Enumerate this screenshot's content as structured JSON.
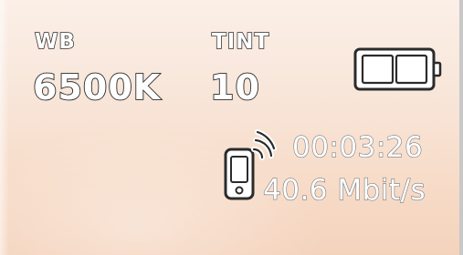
{
  "white_balance": {
    "label": "WB",
    "value": "6500K"
  },
  "tint": {
    "label": "TINT",
    "value": "10"
  },
  "battery": {
    "icon": "battery-icon"
  },
  "stream": {
    "icon": "phone-signal-icon",
    "timecode": "00:03:26",
    "bitrate": "40.6 Mbit/s"
  }
}
